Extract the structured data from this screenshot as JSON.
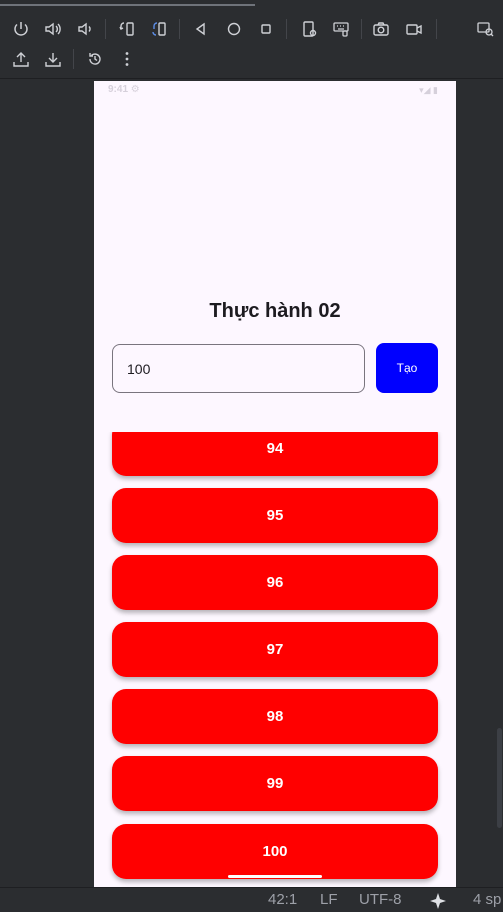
{
  "toolbar": {
    "row1_icons": [
      "power-icon",
      "volume-up-icon",
      "volume-down-icon",
      "rotate-left-icon",
      "rotate-right-icon",
      "back-icon",
      "home-icon",
      "overview-icon",
      "fold-icon",
      "keyboard-icon",
      "screenshot-icon",
      "screen-record-icon",
      "mirror-icon"
    ],
    "row2_icons": [
      "import-icon",
      "export-icon",
      "snapshot-history-icon",
      "more-icon"
    ]
  },
  "phone": {
    "status_bar": {
      "time": "9:41 ⚙",
      "icons": "▾◢ ▮"
    },
    "title": "Thực hành 02",
    "input": {
      "value": "100"
    },
    "create_button": "Tạo",
    "list_items": [
      "94",
      "95",
      "96",
      "97",
      "98",
      "99",
      "100"
    ]
  },
  "ide_status": {
    "position": "42:1",
    "line_ending": "LF",
    "encoding": "UTF-8",
    "ai_icon": "sparkle-icon",
    "indent": "4 sp"
  },
  "colors": {
    "ide_bg": "#2b2d30",
    "phone_bg": "#fdf7ff",
    "item_red": "#ff0000",
    "button_blue": "#0000ff"
  }
}
